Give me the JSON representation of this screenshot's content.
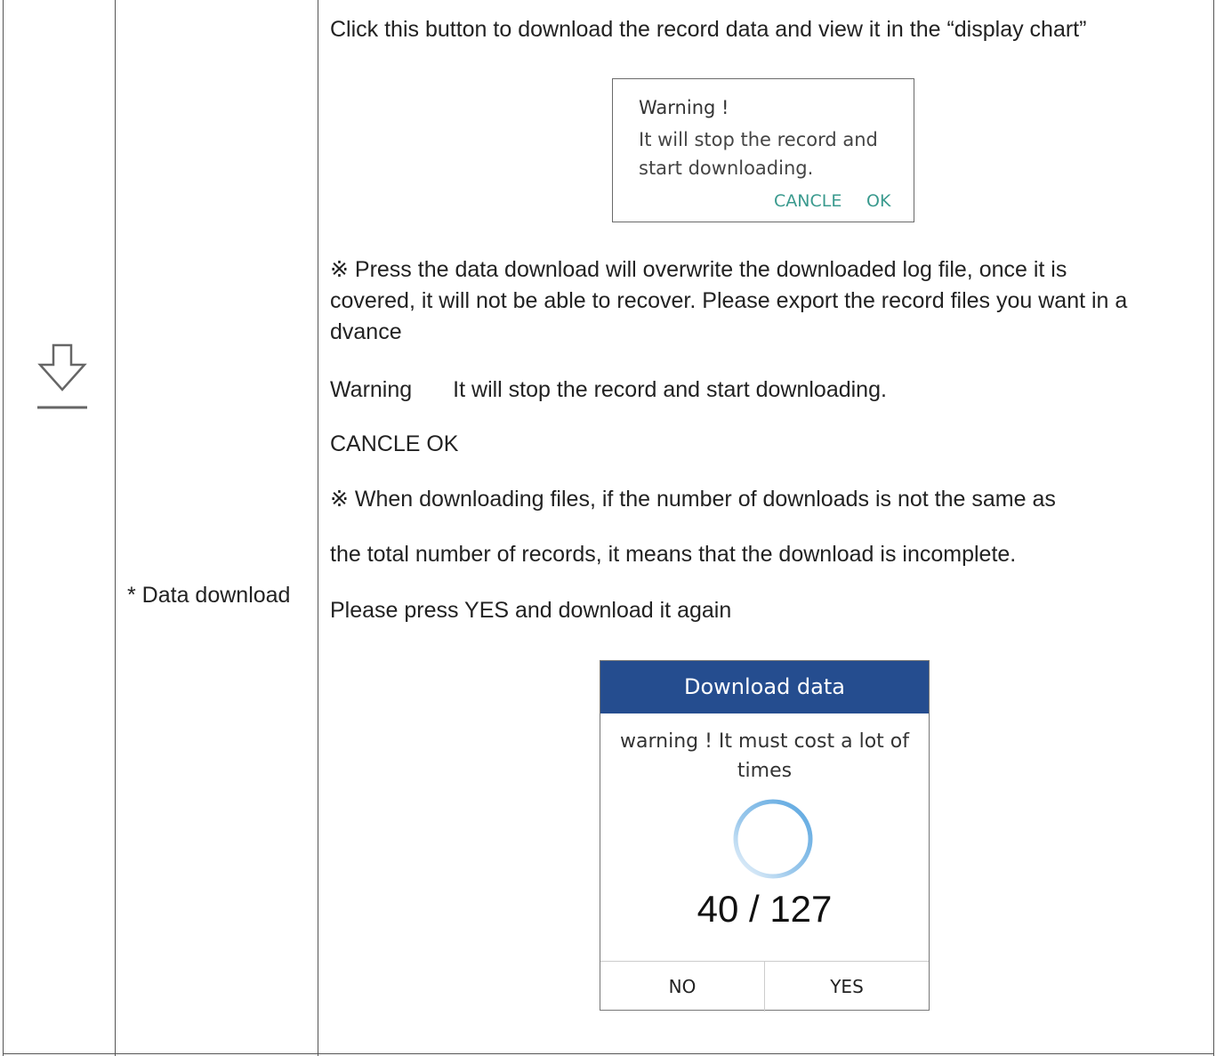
{
  "row": {
    "icon_name": "download-arrow-icon",
    "function_name": "* Data download"
  },
  "description": {
    "line1": "Click this button to download the record data and view it in the “display chart”",
    "note1_line1": "※ Press the data download will overwrite the downloaded log file, once it is",
    "note1_line2": "covered, it will not be able to recover. Please export the record files you want in a",
    "note1_line3": "dvance",
    "warning_label": "Warning",
    "warning_text": "It will stop the record and start downloading.",
    "buttons_text": "CANCLE OK",
    "note2_line1": "※ When downloading files, if the number of downloads is not the same as",
    "note2_line2": "the total number of records, it means that the download is incomplete.",
    "note2_line3": "Please press YES and download it again"
  },
  "warning_dialog": {
    "title": "Warning !",
    "body_line1": "It will stop the record and",
    "body_line2": "start downloading.",
    "cancel_label": "CANCLE",
    "ok_label": "OK",
    "accent_color": "#3a9a8e"
  },
  "download_dialog": {
    "title": "Download data",
    "warning_line1": "warning ! It must cost a lot of",
    "warning_line2": "times",
    "progress_current": "40",
    "progress_total": "127",
    "progress_text": "40 / 127",
    "no_label": "NO",
    "yes_label": "YES",
    "header_color": "#254d8f",
    "spinner_color": "#6aaee0"
  }
}
